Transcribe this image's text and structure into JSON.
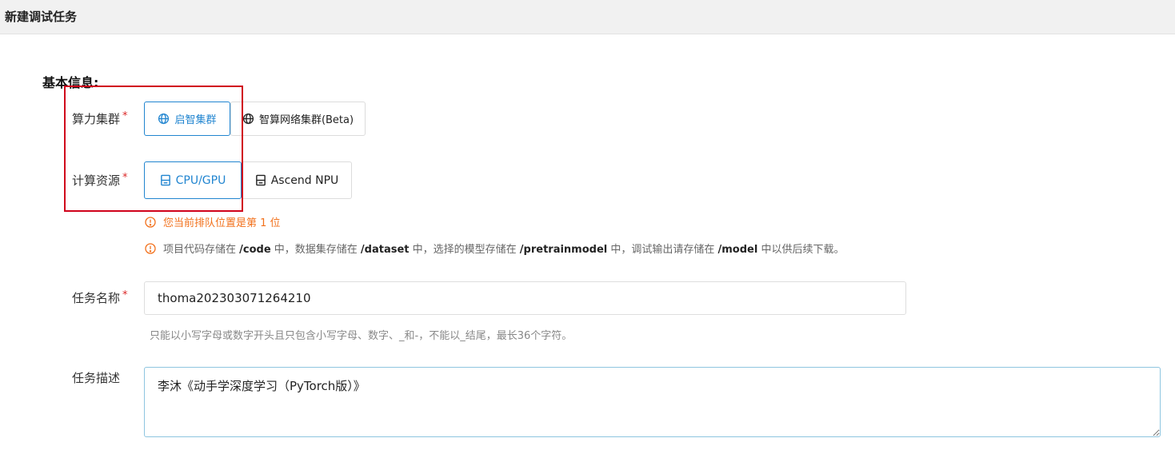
{
  "header": {
    "title": "新建调试任务"
  },
  "section": {
    "title": "基本信息:"
  },
  "cluster": {
    "label": "算力集群",
    "required_mark": "*",
    "options": [
      {
        "label": "启智集群",
        "icon": "globe-icon",
        "selected": true
      },
      {
        "label": "智算网络集群(Beta)",
        "icon": "globe-icon",
        "selected": false
      }
    ]
  },
  "compute": {
    "label": "计算资源",
    "required_mark": "*",
    "options": [
      {
        "label": "CPU/GPU",
        "icon": "server-icon",
        "selected": true
      },
      {
        "label": "Ascend NPU",
        "icon": "server-icon",
        "selected": false
      }
    ]
  },
  "notices": {
    "queue": "您当前排队位置是第 1 位",
    "storage": {
      "p1": "项目代码存储在 ",
      "code_path": "/code",
      "p2": " 中，数据集存储在 ",
      "dataset_path": "/dataset",
      "p3": " 中，选择的模型存储在 ",
      "model_path": "/pretrainmodel",
      "p4": " 中，调试输出请存储在 ",
      "output_path": "/model",
      "p5": " 中以供后续下载。"
    }
  },
  "task_name": {
    "label": "任务名称",
    "required_mark": "*",
    "value": "thoma202303071264210",
    "hint": "只能以小写字母或数字开头且只包含小写字母、数字、_和-，不能以_结尾，最长36个字符。"
  },
  "task_desc": {
    "label": "任务描述",
    "value": "李沐《动手学深度学习（PyTorch版）》"
  },
  "colors": {
    "accent": "#2185d0",
    "required": "#db2828",
    "warning": "#f2711c",
    "highlight_box": "#d0021b"
  }
}
